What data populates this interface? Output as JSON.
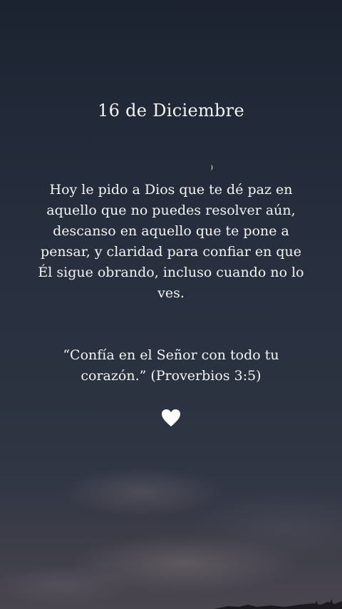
{
  "story": {
    "date_title": "16 de Diciembre",
    "message": "Hoy le pido a Dios que te dé paz en aquello que no puedes resolver aún, descanso en aquello que te pone a pensar, y claridad para confiar en que Él sigue obrando, incluso cuando no lo ves.",
    "quote": "“Confía en el Señor con todo tu corazón.” (Proverbios 3:5)",
    "heart_icon": "white-heart-icon",
    "moon_icon": "crescent-moon-icon"
  },
  "colors": {
    "sky_top": "#1b2230",
    "sky_bottom": "#4a4650",
    "text": "#f4f4f2",
    "heart": "#ffffff"
  }
}
